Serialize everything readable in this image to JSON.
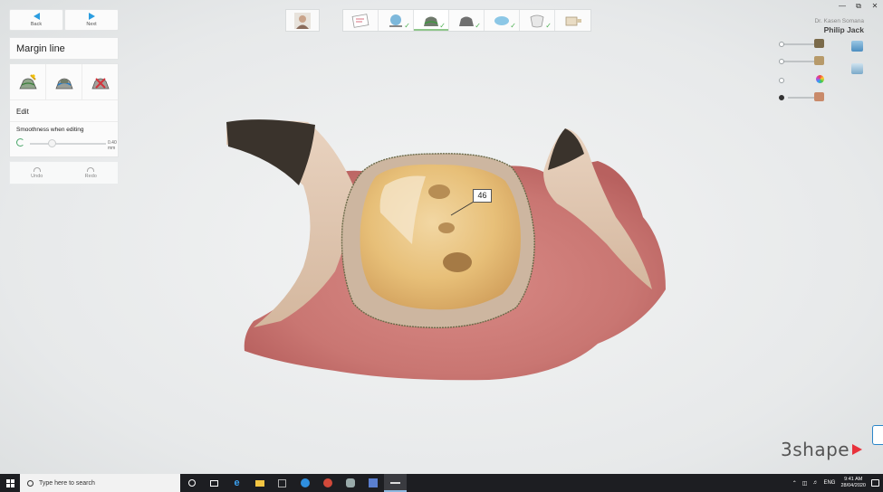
{
  "nav": {
    "back_label": "Back",
    "next_label": "Next"
  },
  "panel": {
    "title": "Margin line",
    "edit_label": "Edit",
    "smoothness_label": "Smoothness when editing",
    "smoothness_value": "0.40 mm",
    "undo_label": "Undo",
    "redo_label": "Redo"
  },
  "user": {
    "doctor": "Dr. Kasen Somana",
    "patient": "Philip Jack"
  },
  "tooth": {
    "number": "46"
  },
  "brand": {
    "name": "3shape"
  },
  "taskbar": {
    "search_placeholder": "Type here to search",
    "language": "ENG",
    "time": "9:41 AM",
    "date": "28/04/2020"
  },
  "colors": {
    "accent": "#2b9de0",
    "check": "#4caf50",
    "brand": "#e8323c"
  }
}
